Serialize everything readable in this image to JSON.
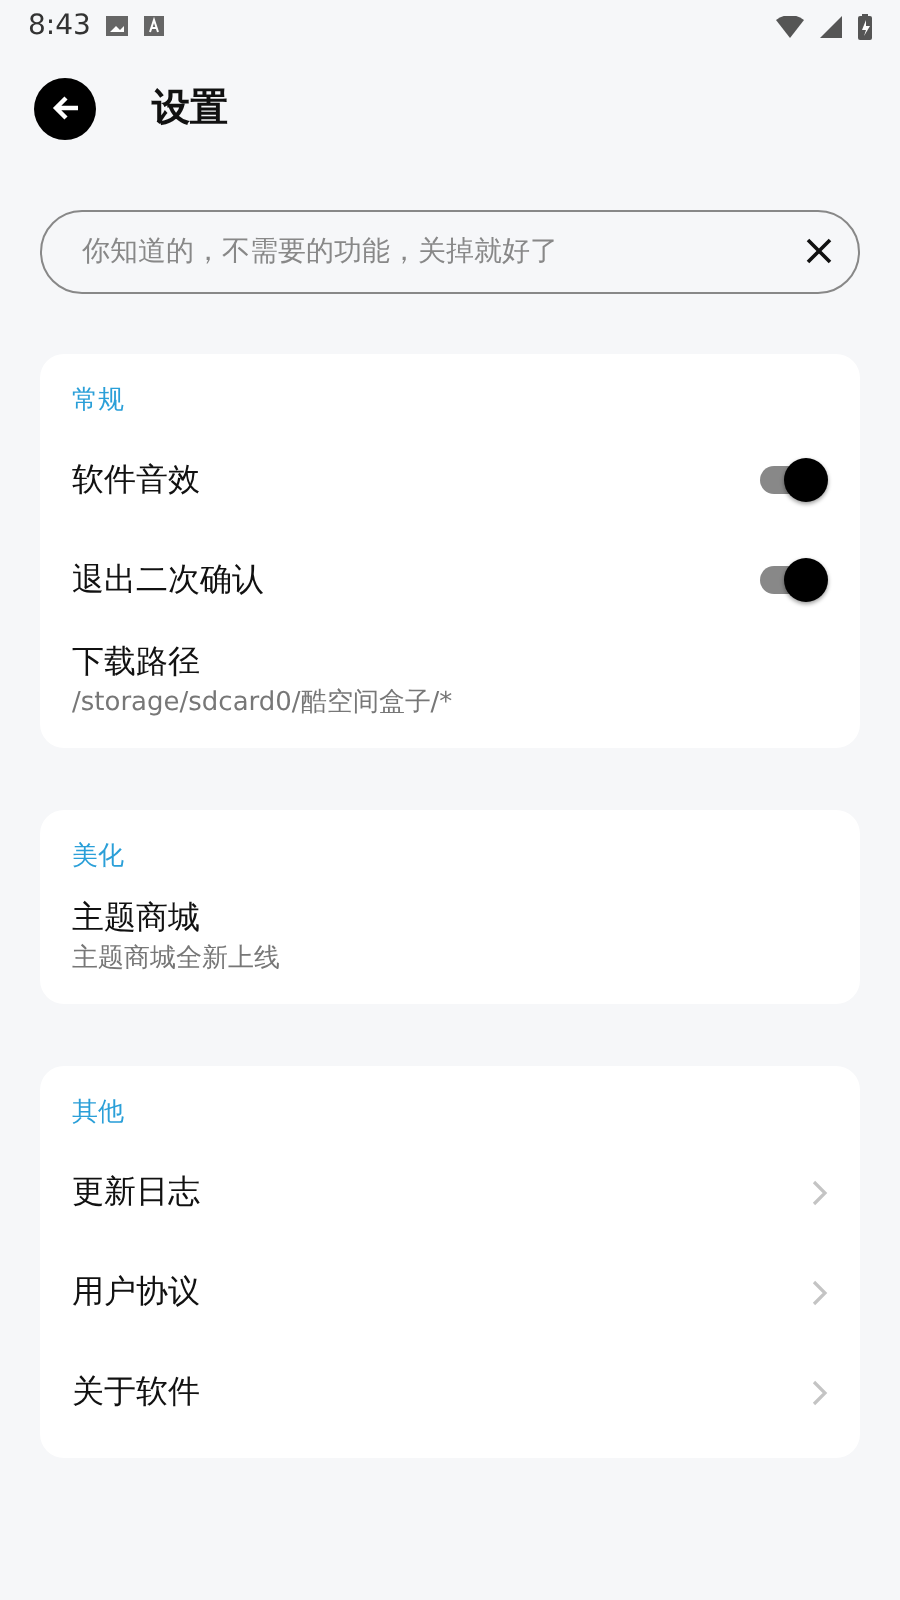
{
  "status_bar": {
    "time": "8:43"
  },
  "header": {
    "title": "设置"
  },
  "search": {
    "placeholder": "你知道的，不需要的功能，关掉就好了"
  },
  "sections": [
    {
      "title": "常规",
      "items": [
        {
          "kind": "toggle",
          "label": "软件音效",
          "on": true
        },
        {
          "kind": "toggle",
          "label": "退出二次确认",
          "on": true
        },
        {
          "kind": "subtitle",
          "label": "下载路径",
          "subtitle": "/storage/sdcard0/酷空间盒子/*"
        }
      ]
    },
    {
      "title": "美化",
      "items": [
        {
          "kind": "subtitle",
          "label": "主题商城",
          "subtitle": "主题商城全新上线"
        }
      ]
    },
    {
      "title": "其他",
      "items": [
        {
          "kind": "link",
          "label": "更新日志"
        },
        {
          "kind": "link",
          "label": "用户协议"
        },
        {
          "kind": "link",
          "label": "关于软件"
        }
      ]
    }
  ]
}
